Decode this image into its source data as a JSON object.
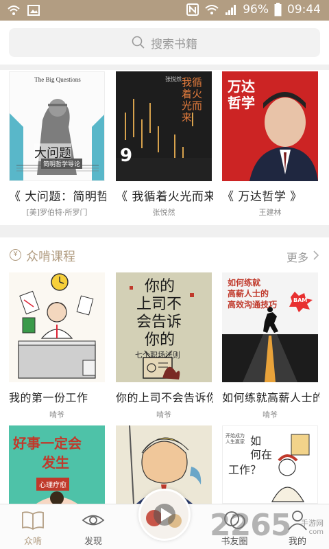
{
  "status_bar": {
    "battery": "96%",
    "time": "09:44",
    "icons": [
      "wifi-icon",
      "image-icon",
      "nfc-icon",
      "wifi-signal-icon",
      "cell-signal-icon",
      "battery-icon"
    ]
  },
  "search": {
    "placeholder": "搜索书籍",
    "icon": "search-icon"
  },
  "books": [
    {
      "title": "《 大问题：简明哲学导论",
      "author": "[美]罗伯特·所罗门",
      "cover_text_en": "The Big Questions",
      "cover_title": "大问题",
      "cover_subtitle": "简明哲学导论"
    },
    {
      "title": "《 我循着火光而来",
      "author": "张悦然",
      "cover_title": "我循着火光而来",
      "cover_author": "张悦然",
      "cover_number": "9"
    },
    {
      "title": "《 万达哲学 》",
      "author": "王建林",
      "cover_title": "万达哲学"
    }
  ],
  "section": {
    "badge": "¥",
    "title": "众啃课程",
    "more": "更多"
  },
  "courses": [
    {
      "title": "我的第一份工作",
      "author": "啃爷"
    },
    {
      "title": "你的上司不会告诉你的",
      "author": "啃爷",
      "cover_lines": [
        "你的",
        "上司不",
        "会告诉",
        "你的"
      ],
      "cover_sub": "七个职场法则"
    },
    {
      "title": "如何练就高薪人士的高效沟通技巧",
      "author": "啃爷",
      "cover_lines": [
        "如何练就",
        "高薪人士的",
        "高效沟通技巧"
      ],
      "cover_bubble": "BAM"
    },
    {
      "title": "",
      "author": "",
      "cover_lines": [
        "好事一定会",
        "发生"
      ],
      "cover_tag": "心理疗愈"
    },
    {
      "title": "",
      "author": ""
    },
    {
      "title": "",
      "author": "",
      "cover_lines": [
        "如",
        "何在",
        "工作？"
      ],
      "cover_small": "开始成为人生赢家"
    }
  ],
  "bottom_nav": [
    {
      "label": "众啃",
      "icon": "book-icon",
      "active": true
    },
    {
      "label": "发现",
      "icon": "eye-icon",
      "active": false
    },
    {
      "label": "书友圈",
      "icon": "chat-icon",
      "active": false
    },
    {
      "label": "我的",
      "icon": "person-icon",
      "active": false
    }
  ],
  "play_button": {
    "icon": "play-icon"
  },
  "watermark": {
    "number": "2265",
    "suffix": "手游网",
    "url": "com"
  },
  "colors": {
    "accent": "#b29d82",
    "muted": "#9a9a9a",
    "text": "#222222",
    "divider": "#f0f0f0"
  }
}
